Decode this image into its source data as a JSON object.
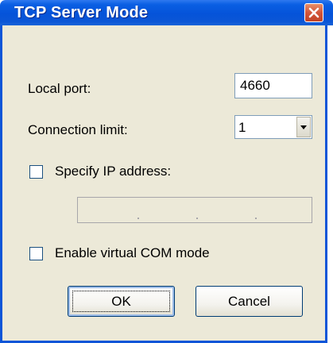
{
  "window": {
    "title": "TCP Server Mode",
    "close_icon": "close-icon"
  },
  "form": {
    "local_port_label": "Local port:",
    "local_port_value": "4660",
    "connection_limit_label": "Connection limit:",
    "connection_limit_value": "1",
    "specify_ip_label": "Specify IP address:",
    "specify_ip_checked": false,
    "ip_address_value": "",
    "virtual_com_label": "Enable virtual COM mode",
    "virtual_com_checked": false
  },
  "buttons": {
    "ok_label": "OK",
    "cancel_label": "Cancel"
  },
  "colors": {
    "titlebar": "#0553d9",
    "dialog_background": "#ece9d8",
    "close_button": "#d2553a"
  }
}
